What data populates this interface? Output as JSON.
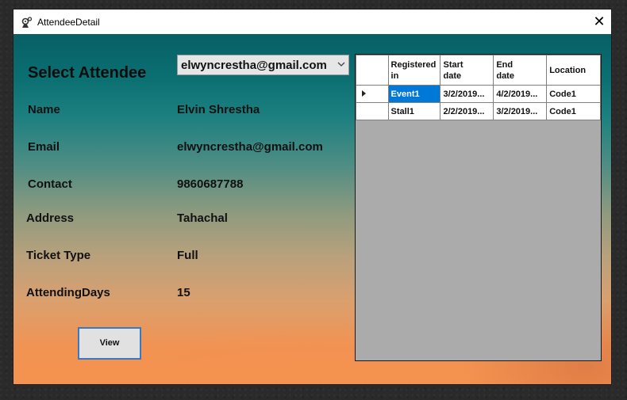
{
  "window": {
    "title": "AttendeeDetail",
    "close_glyph": "✕"
  },
  "form": {
    "select_label": "Select Attendee",
    "selected_email": "elwyncrestha@gmail.com",
    "fields": [
      {
        "label": "Name",
        "value": "Elvin Shrestha"
      },
      {
        "label": "Email",
        "value": "elwyncrestha@gmail.com"
      },
      {
        "label": "Contact",
        "value": "9860687788"
      },
      {
        "label": "Address",
        "value": "Tahachal"
      },
      {
        "label": "Ticket Type",
        "value": "Full"
      },
      {
        "label": "AttendingDays",
        "value": "15"
      }
    ],
    "view_button": "View"
  },
  "grid": {
    "columns": [
      "Registered in",
      "Start date",
      "End date",
      "Location"
    ],
    "column_lines": [
      [
        "Registered",
        "in"
      ],
      [
        "Start",
        "date"
      ],
      [
        "End",
        "date"
      ],
      [
        "Location",
        ""
      ]
    ],
    "rows": [
      {
        "current": true,
        "cells": [
          "Event1",
          "3/2/2019...",
          "4/2/2019...",
          "Code1"
        ]
      },
      {
        "current": false,
        "cells": [
          "Stall1",
          "2/2/2019...",
          "3/2/2019...",
          "Code1"
        ]
      }
    ]
  },
  "colors": {
    "selection": "#0078d7",
    "grid_bg": "#ababab",
    "button_border": "#3a78c0"
  },
  "icons": [
    "app-gears-icon",
    "close-icon",
    "chevron-down-icon",
    "row-pointer-icon"
  ]
}
